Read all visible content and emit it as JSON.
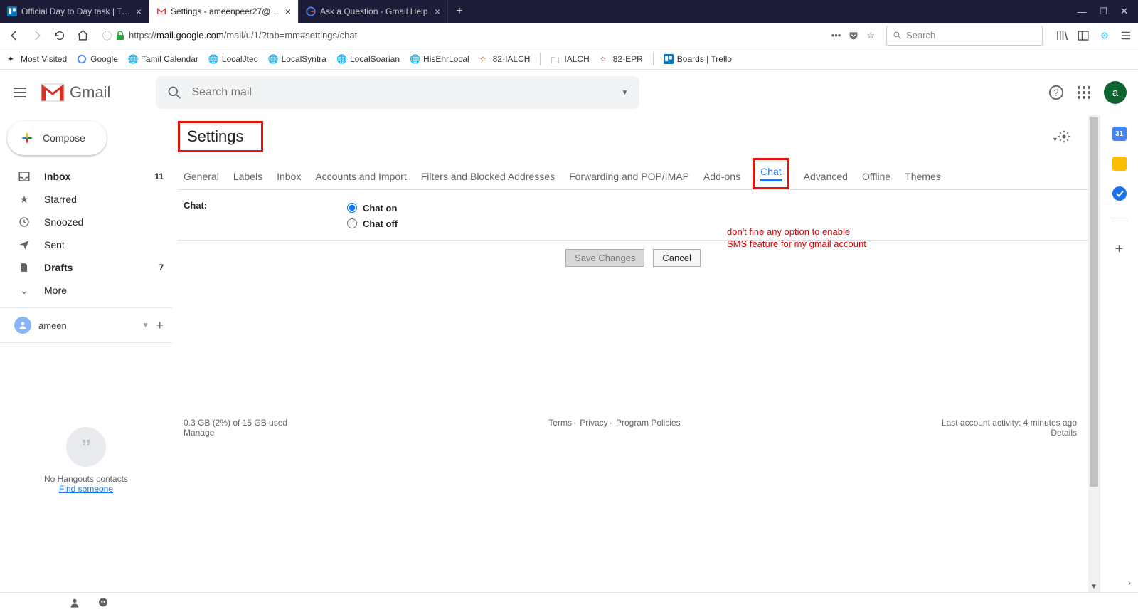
{
  "browser": {
    "tabs": [
      {
        "label": "Official Day to Day task | Trello"
      },
      {
        "label": "Settings - ameenpeer27@gmail"
      },
      {
        "label": "Ask a Question - Gmail Help"
      }
    ],
    "url_prefix": "https://",
    "url_host": "mail.google.com",
    "url_path": "/mail/u/1/?tab=mm#settings/chat",
    "search_placeholder": "Search",
    "bookmarks": [
      "Most Visited",
      "Google",
      "Tamil Calendar",
      "LocalJtec",
      "LocalSyntra",
      "LocalSoarian",
      "HisEhrLocal",
      "82-IALCH",
      "IALCH",
      "82-EPR",
      "Boards | Trello"
    ]
  },
  "gmail": {
    "product": "Gmail",
    "search_placeholder": "Search mail",
    "avatar_letter": "a",
    "compose": "Compose",
    "nav": [
      {
        "icon": "inbox",
        "label": "Inbox",
        "count": "11",
        "bold": true
      },
      {
        "icon": "star",
        "label": "Starred"
      },
      {
        "icon": "clock",
        "label": "Snoozed"
      },
      {
        "icon": "send",
        "label": "Sent"
      },
      {
        "icon": "file",
        "label": "Drafts",
        "count": "7",
        "bold": true
      },
      {
        "icon": "more",
        "label": "More"
      }
    ],
    "user_chip": "ameen",
    "hangouts_empty": "No Hangouts contacts",
    "find_someone": "Find someone",
    "right_rail_cal": "31"
  },
  "settings": {
    "title": "Settings",
    "tabs": [
      "General",
      "Labels",
      "Inbox",
      "Accounts and Import",
      "Filters and Blocked Addresses",
      "Forwarding and POP/IMAP",
      "Add-ons",
      "Chat",
      "Advanced",
      "Offline",
      "Themes"
    ],
    "active_tab": "Chat",
    "chat_label": "Chat:",
    "chat_on": "Chat on",
    "chat_off": "Chat off",
    "save": "Save Changes",
    "cancel": "Cancel",
    "annotation_l1": "don't fine any option to enable",
    "annotation_l2": "SMS feature for my gmail account"
  },
  "footer": {
    "storage": "0.3 GB (2%) of 15 GB used",
    "manage": "Manage",
    "terms": "Terms",
    "privacy": "Privacy",
    "policies": "Program Policies",
    "activity": "Last account activity: 4 minutes ago",
    "details": "Details"
  }
}
